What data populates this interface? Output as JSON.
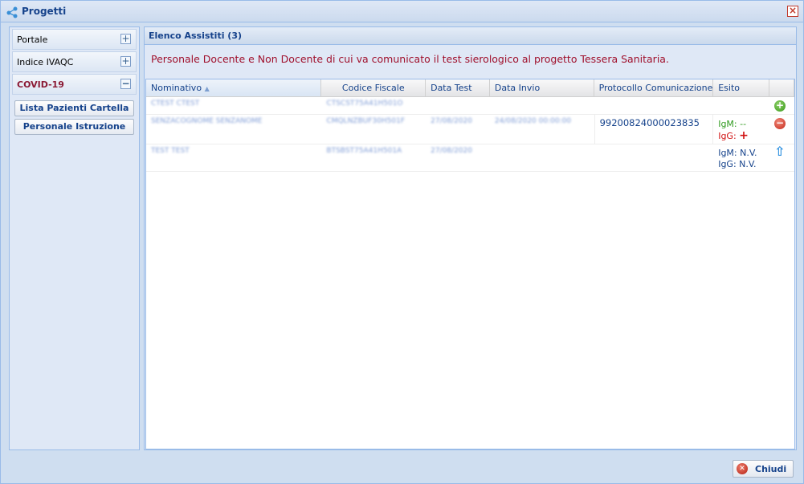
{
  "window": {
    "title": "Progetti",
    "close_icon": "close-icon"
  },
  "sidebar": {
    "sections": [
      {
        "label": "Portale",
        "state": "collapsed",
        "tool": "+"
      },
      {
        "label": "Indice IVAQC",
        "state": "collapsed",
        "tool": "+"
      },
      {
        "label": "COVID-19",
        "state": "expanded",
        "tool": "−"
      }
    ],
    "covid_buttons": [
      "Lista Pazienti Cartella",
      "Personale Istruzione"
    ]
  },
  "main": {
    "header": "Elenco Assistiti (3)",
    "notice": "Personale Docente e Non Docente di cui va comunicato il test sierologico al progetto Tessera Sanitaria.",
    "columns": [
      "Nominativo",
      "Codice Fiscale",
      "Data Test",
      "Data Invio",
      "Protocollo Comunicazione",
      "Esito",
      ""
    ],
    "rows": [
      {
        "nominativo": "CTEST CTEST",
        "codice_fiscale": "CTSCST75A41H501O",
        "data_test": "",
        "data_invio": "",
        "protocollo": "",
        "igm": "",
        "igg": "",
        "action": "add"
      },
      {
        "nominativo": "SENZACOGNOME SENZANOME",
        "codice_fiscale": "CMQLNZBUF30H501F",
        "data_test": "27/08/2020",
        "data_invio": "24/08/2020 00:00:00",
        "protocollo": "99200824000023835",
        "igm_label": "IgM:",
        "igm": "--",
        "igg_label": "IgG:",
        "igg": "+",
        "action": "remove"
      },
      {
        "nominativo": "TEST TEST",
        "codice_fiscale": "BTSBST75A41H501A",
        "data_test": "27/08/2020",
        "data_invio": "",
        "protocollo": "",
        "igm_label": "IgM:",
        "igm": "N.V.",
        "igg_label": "IgG:",
        "igg": "N.V.",
        "action": "upload"
      }
    ]
  },
  "footer": {
    "close_label": "Chiudi"
  }
}
